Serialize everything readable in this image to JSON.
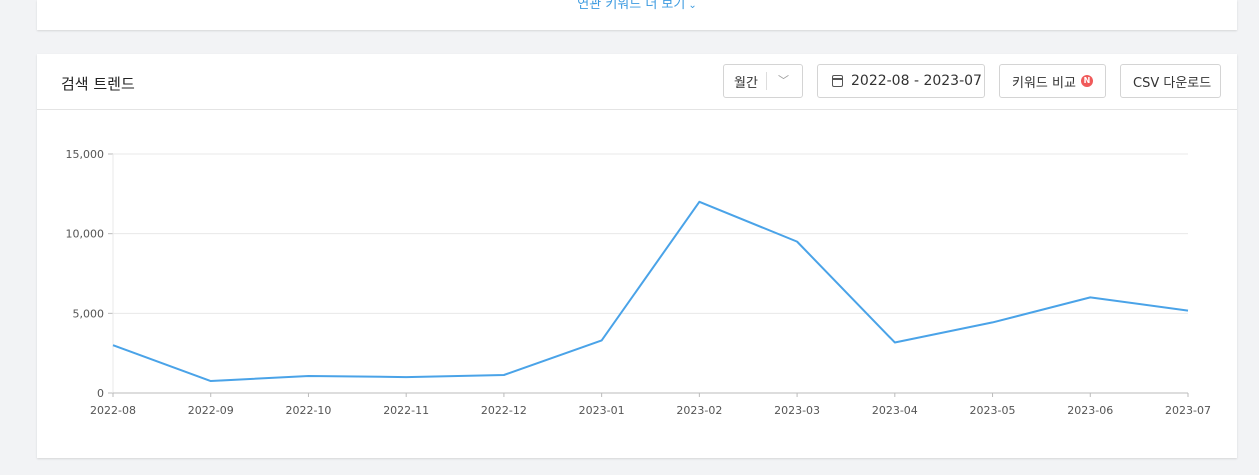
{
  "more_keywords": {
    "label": "연관 키워드 더 보기"
  },
  "card": {
    "title": "검색 트렌드",
    "period": "월간",
    "date_range": "2022-08 - 2023-07",
    "compare_label": "키워드 비교",
    "new_badge": "N",
    "csv_label": "CSV 다운로드"
  },
  "colors": {
    "line": "#4aa3e8",
    "grid": "#e8e8e8",
    "axis": "#bbbbbb",
    "tick_text": "#555555"
  },
  "chart_data": {
    "type": "line",
    "title": "",
    "xlabel": "",
    "ylabel": "",
    "categories": [
      "2022-08",
      "2022-09",
      "2022-10",
      "2022-11",
      "2022-12",
      "2023-01",
      "2023-02",
      "2023-03",
      "2023-04",
      "2023-05",
      "2023-06",
      "2023-07"
    ],
    "series": [
      {
        "values": [
          3000,
          750,
          1070,
          1000,
          1130,
          3300,
          12000,
          9500,
          3170,
          4430,
          6000,
          5170
        ]
      }
    ],
    "ylim": [
      0,
      15000
    ],
    "yticks": [
      0,
      5000,
      10000,
      15000
    ],
    "ytick_labels": [
      "0",
      "5,000",
      "10,000",
      "15,000"
    ],
    "grid": true,
    "legend": "none"
  }
}
